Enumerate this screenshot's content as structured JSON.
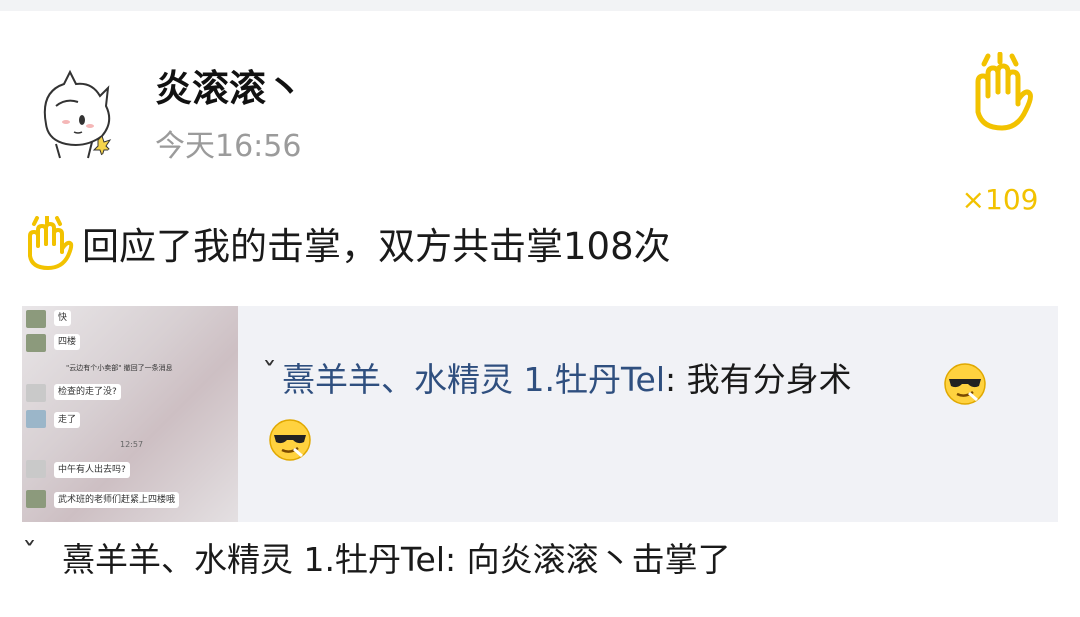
{
  "post": {
    "username": "炎滚滚丶",
    "timestamp": "今天16:56",
    "clap_count": "×109",
    "message": "回应了我的击掌，双方共击掌108次"
  },
  "quote": {
    "author": "熹羊羊、水精灵 1.牡丹Tel",
    "separator": ":",
    "text": "我有分身术",
    "emoji": "cool-sunglasses-emoji"
  },
  "thumbnail": {
    "chat_lines": [
      "快",
      "四楼",
      "\"云边有个小卖部\" 撤回了一条消息",
      "检查的走了没?",
      "走了",
      "12:57",
      "中午有人出去吗?",
      "武术班的老师们赶紧上四楼哦"
    ]
  },
  "footer": {
    "text": "熹羊羊、水精灵 1.牡丹Tel: 向炎滚滚丶击掌了"
  },
  "colors": {
    "accent_yellow": "#f2c200",
    "author_blue": "#2f4f7f",
    "card_bg": "#f1f2f6"
  }
}
